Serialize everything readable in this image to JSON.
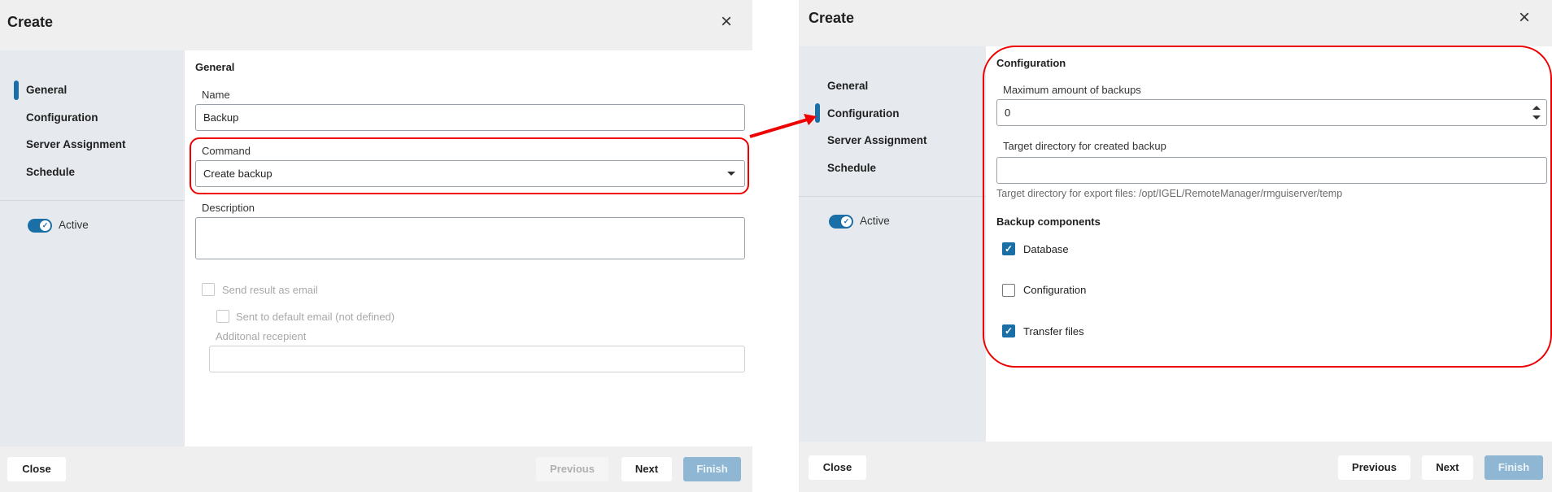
{
  "left": {
    "title": "Create",
    "nav": [
      "General",
      "Configuration",
      "Server Assignment",
      "Schedule"
    ],
    "active_label": "Active",
    "section": "General",
    "name_label": "Name",
    "name_value": "Backup",
    "command_label": "Command",
    "command_value": "Create backup",
    "description_label": "Description",
    "description_value": "",
    "send_email_label": "Send result as email",
    "default_email_label": "Sent to default email (not defined)",
    "additional_recipient_label": "Additonal recepient",
    "additional_recipient_value": "",
    "buttons": {
      "close": "Close",
      "previous": "Previous",
      "next": "Next",
      "finish": "Finish"
    }
  },
  "right": {
    "title": "Create",
    "nav": [
      "General",
      "Configuration",
      "Server Assignment",
      "Schedule"
    ],
    "active_label": "Active",
    "section": "Configuration",
    "max_backups_label": "Maximum amount of backups",
    "max_backups_value": "0",
    "target_dir_label": "Target directory for created backup",
    "target_dir_value": "",
    "target_dir_help": "Target directory for export files: /opt/IGEL/RemoteManager/rmguiserver/temp",
    "components_label": "Backup components",
    "components": [
      {
        "label": "Database",
        "checked": true
      },
      {
        "label": "Configuration",
        "checked": false
      },
      {
        "label": "Transfer files",
        "checked": true
      }
    ],
    "buttons": {
      "close": "Close",
      "previous": "Previous",
      "next": "Next",
      "finish": "Finish"
    }
  },
  "colors": {
    "accent": "#1a6fa7",
    "highlight": "#e00000"
  },
  "icons": [
    "close-icon",
    "dropdown-arrow-icon",
    "check-icon",
    "spinner-arrows-icon"
  ]
}
